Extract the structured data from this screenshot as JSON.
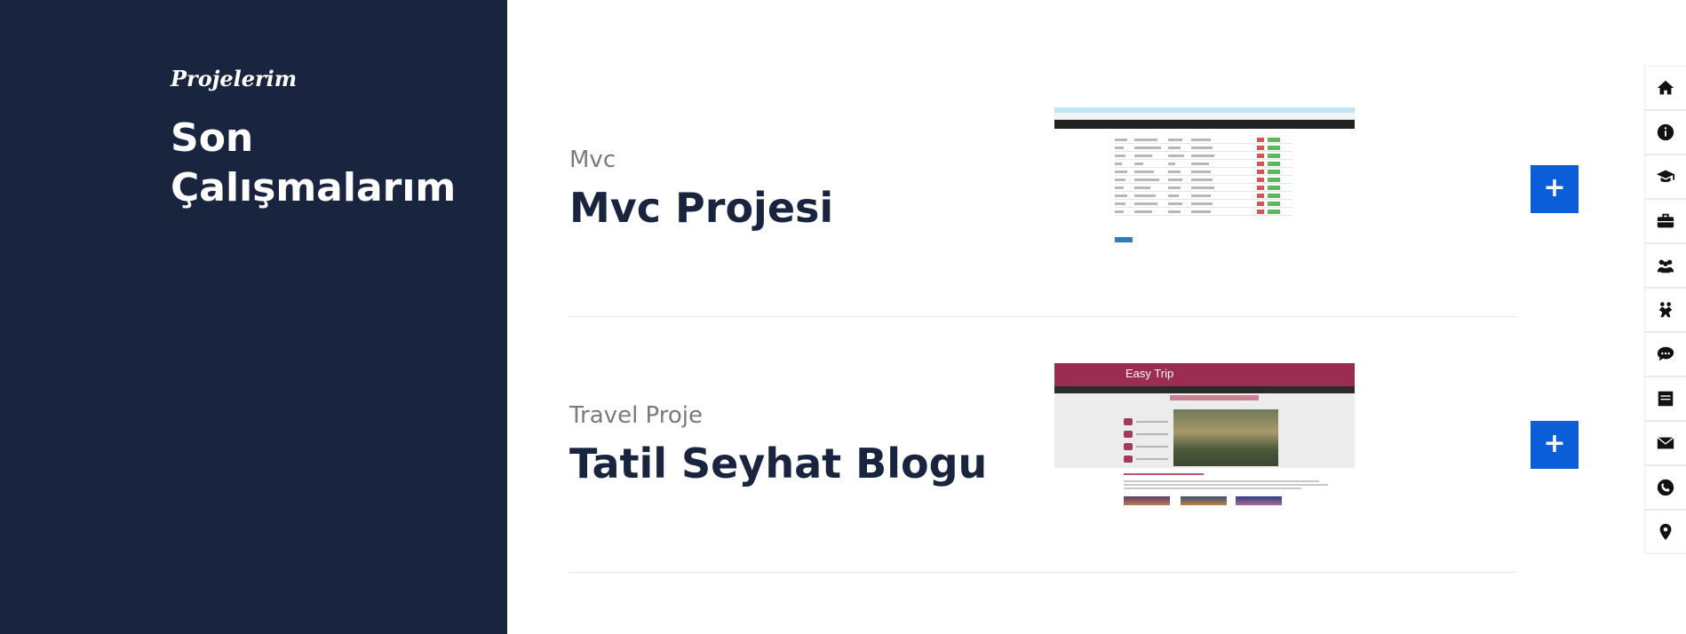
{
  "sidebar_left": {
    "eyebrow": "Projelerim",
    "heading": "Son Çalışmalarım"
  },
  "projects": [
    {
      "category": "Mvc",
      "title": "Mvc Projesi",
      "button_label": "+"
    },
    {
      "category": "Travel Proje",
      "title": "Tatil Seyhat Blogu",
      "button_label": "+",
      "thumb_logo": "Easy Trip"
    }
  ],
  "right_nav": [
    {
      "icon": "home-icon"
    },
    {
      "icon": "info-icon"
    },
    {
      "icon": "graduation-cap-icon"
    },
    {
      "icon": "briefcase-icon"
    },
    {
      "icon": "users-icon"
    },
    {
      "icon": "handshake-icon"
    },
    {
      "icon": "chat-icon"
    },
    {
      "icon": "blog-post-icon"
    },
    {
      "icon": "envelope-icon"
    },
    {
      "icon": "phone-icon"
    },
    {
      "icon": "map-marker-icon"
    }
  ],
  "colors": {
    "panel": "#19243f",
    "accent": "#0b5ed7",
    "travel_header": "#9c2d52"
  }
}
